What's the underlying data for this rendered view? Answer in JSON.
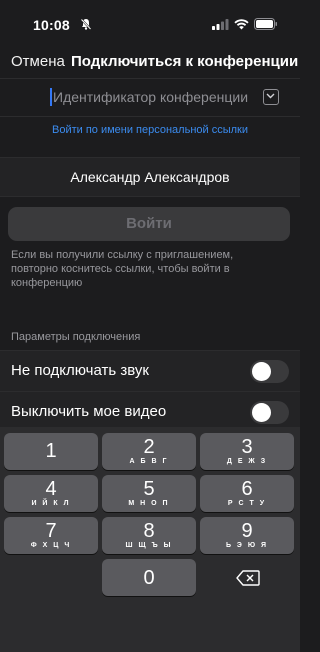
{
  "status_bar": {
    "time": "10:08"
  },
  "nav": {
    "cancel_label": "Отмена",
    "title": "Подключиться к конференции"
  },
  "meeting_id": {
    "placeholder": "Идентификатор конференции",
    "value": ""
  },
  "personal_link": {
    "label": "Войти по имени персональной ссылки"
  },
  "display_name": {
    "value": "Александр Александров"
  },
  "join_button": {
    "label": "Войти"
  },
  "hint": {
    "text": "Если вы получили ссылку с приглашением, повторно коснитесь ссылки, чтобы войти в конференцию"
  },
  "options": {
    "section_title": "Параметры подключения",
    "items": [
      {
        "label": "Не подключать звук",
        "on": false
      },
      {
        "label": "Выключить мое видео",
        "on": false
      }
    ]
  },
  "keypad": {
    "keys": [
      {
        "digit": "1",
        "letters": ""
      },
      {
        "digit": "2",
        "letters": "А Б В Г"
      },
      {
        "digit": "3",
        "letters": "Д Е Ж З"
      },
      {
        "digit": "4",
        "letters": "И Й К Л"
      },
      {
        "digit": "5",
        "letters": "М Н О П"
      },
      {
        "digit": "6",
        "letters": "Р С Т У"
      },
      {
        "digit": "7",
        "letters": "Ф Х Ц Ч"
      },
      {
        "digit": "8",
        "letters": "Ш Щ Ъ Ы"
      },
      {
        "digit": "9",
        "letters": "Ь Э Ю Я"
      },
      {
        "digit": "0",
        "letters": ""
      }
    ]
  },
  "colors": {
    "accent": "#3b8cf0",
    "background": "#1c1c1e",
    "key": "#5a5a5e"
  }
}
